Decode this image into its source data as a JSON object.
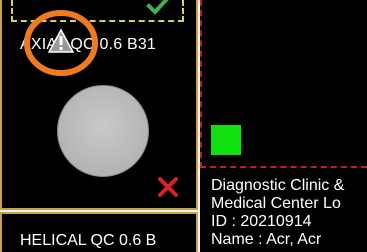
{
  "series": [
    {
      "label": "AXIAL QC 0.6 B31",
      "status": "warning",
      "selected": true
    },
    {
      "label": "HELICAL QC 0.6 B"
    }
  ],
  "viewer": {
    "marker_color": "#10e010",
    "info": {
      "institution": "Diagnostic Clinic &",
      "department": "Medical Center Lo",
      "id": "ID : 20210914",
      "name": "Name : Acr, Acr"
    }
  },
  "colors": {
    "warning_ring": "#f07a20",
    "accept_check": "#3fb34a",
    "reject_x": "#e02020"
  }
}
